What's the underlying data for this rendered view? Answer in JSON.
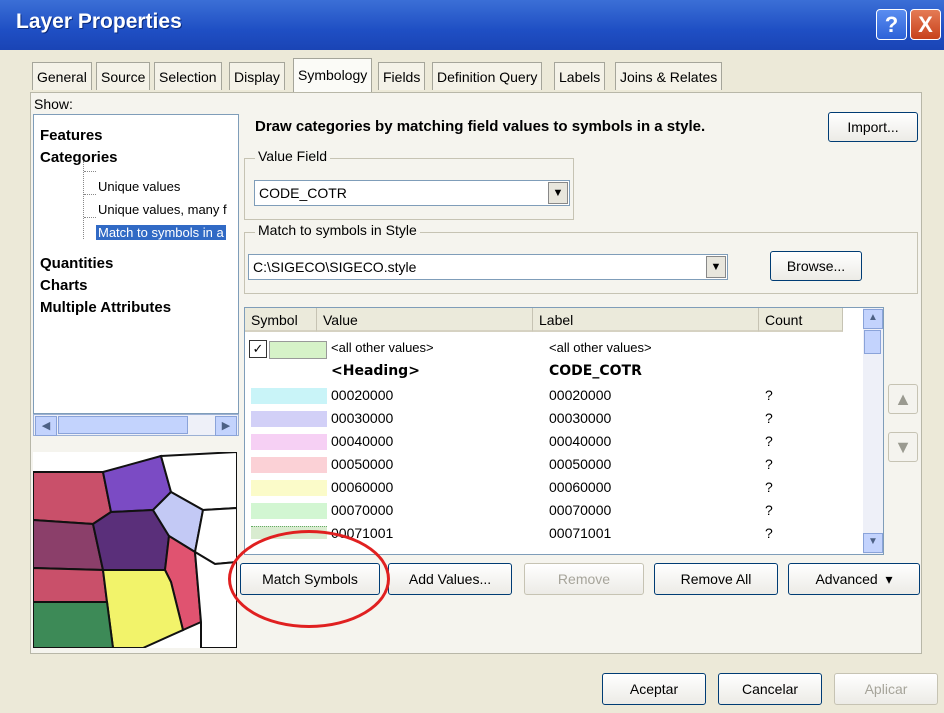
{
  "window": {
    "title": "Layer Properties",
    "help_label": "?",
    "close_label": "X"
  },
  "tabs": [
    "General",
    "Source",
    "Selection",
    "Display",
    "Symbology",
    "Fields",
    "Definition Query",
    "Labels",
    "Joins & Relates"
  ],
  "active_tab": "Symbology",
  "show": {
    "label": "Show:",
    "items": [
      "Features",
      "Categories",
      "Unique values",
      "Unique values, many f",
      "Match to symbols in a",
      "Quantities",
      "Charts",
      "Multiple Attributes"
    ]
  },
  "description": "Draw categories by matching field values to symbols in a style.",
  "import_label": "Import...",
  "value_field": {
    "label": "Value Field",
    "value": "CODE_COTR"
  },
  "style": {
    "label": "Match to symbols in Style",
    "value": "C:\\SIGECO\\SIGECO.style",
    "browse_label": "Browse..."
  },
  "table": {
    "columns": [
      "Symbol",
      "Value",
      "Label",
      "Count"
    ],
    "rows": [
      {
        "value": "<all other values>",
        "label": "<all other values>",
        "count": "",
        "color": "#d6f2c8"
      },
      {
        "value": "<Heading>",
        "label": "CODE_COTR",
        "count": "",
        "color": ""
      },
      {
        "value": "00020000",
        "label": "00020000",
        "count": "?",
        "color": "#c9f4f8"
      },
      {
        "value": "00030000",
        "label": "00030000",
        "count": "?",
        "color": "#d2d0f7"
      },
      {
        "value": "00040000",
        "label": "00040000",
        "count": "?",
        "color": "#f6d0f4"
      },
      {
        "value": "00050000",
        "label": "00050000",
        "count": "?",
        "color": "#fbd1d6"
      },
      {
        "value": "00060000",
        "label": "00060000",
        "count": "?",
        "color": "#fbfbc9"
      },
      {
        "value": "00070000",
        "label": "00070000",
        "count": "?",
        "color": "#d2f6d2"
      },
      {
        "value": "00071001",
        "label": "00071001",
        "count": "?",
        "color": "#d9ecd0"
      }
    ]
  },
  "buttons": {
    "match_symbols": "Match Symbols",
    "add_values": "Add Values...",
    "remove": "Remove",
    "remove_all": "Remove All",
    "advanced": "Advanced"
  },
  "footer": {
    "ok": "Aceptar",
    "cancel": "Cancelar",
    "apply": "Aplicar"
  },
  "colors": {
    "selection": "#316ac5",
    "annotation": "#e02020",
    "title_bar": "#1f4fc4"
  }
}
